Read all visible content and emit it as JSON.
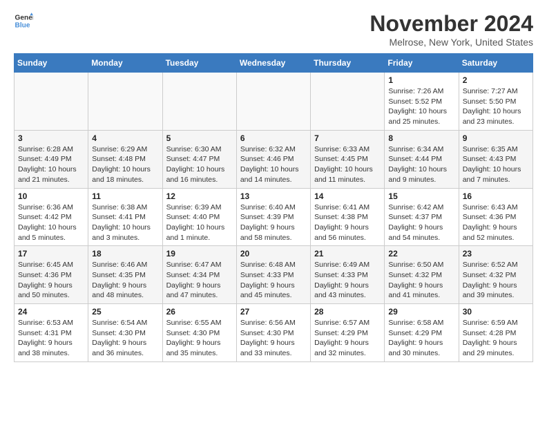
{
  "logo": {
    "line1": "General",
    "line2": "Blue"
  },
  "title": "November 2024",
  "location": "Melrose, New York, United States",
  "weekdays": [
    "Sunday",
    "Monday",
    "Tuesday",
    "Wednesday",
    "Thursday",
    "Friday",
    "Saturday"
  ],
  "weeks": [
    [
      {
        "day": "",
        "info": ""
      },
      {
        "day": "",
        "info": ""
      },
      {
        "day": "",
        "info": ""
      },
      {
        "day": "",
        "info": ""
      },
      {
        "day": "",
        "info": ""
      },
      {
        "day": "1",
        "info": "Sunrise: 7:26 AM\nSunset: 5:52 PM\nDaylight: 10 hours and 25 minutes."
      },
      {
        "day": "2",
        "info": "Sunrise: 7:27 AM\nSunset: 5:50 PM\nDaylight: 10 hours and 23 minutes."
      }
    ],
    [
      {
        "day": "3",
        "info": "Sunrise: 6:28 AM\nSunset: 4:49 PM\nDaylight: 10 hours and 21 minutes."
      },
      {
        "day": "4",
        "info": "Sunrise: 6:29 AM\nSunset: 4:48 PM\nDaylight: 10 hours and 18 minutes."
      },
      {
        "day": "5",
        "info": "Sunrise: 6:30 AM\nSunset: 4:47 PM\nDaylight: 10 hours and 16 minutes."
      },
      {
        "day": "6",
        "info": "Sunrise: 6:32 AM\nSunset: 4:46 PM\nDaylight: 10 hours and 14 minutes."
      },
      {
        "day": "7",
        "info": "Sunrise: 6:33 AM\nSunset: 4:45 PM\nDaylight: 10 hours and 11 minutes."
      },
      {
        "day": "8",
        "info": "Sunrise: 6:34 AM\nSunset: 4:44 PM\nDaylight: 10 hours and 9 minutes."
      },
      {
        "day": "9",
        "info": "Sunrise: 6:35 AM\nSunset: 4:43 PM\nDaylight: 10 hours and 7 minutes."
      }
    ],
    [
      {
        "day": "10",
        "info": "Sunrise: 6:36 AM\nSunset: 4:42 PM\nDaylight: 10 hours and 5 minutes."
      },
      {
        "day": "11",
        "info": "Sunrise: 6:38 AM\nSunset: 4:41 PM\nDaylight: 10 hours and 3 minutes."
      },
      {
        "day": "12",
        "info": "Sunrise: 6:39 AM\nSunset: 4:40 PM\nDaylight: 10 hours and 1 minute."
      },
      {
        "day": "13",
        "info": "Sunrise: 6:40 AM\nSunset: 4:39 PM\nDaylight: 9 hours and 58 minutes."
      },
      {
        "day": "14",
        "info": "Sunrise: 6:41 AM\nSunset: 4:38 PM\nDaylight: 9 hours and 56 minutes."
      },
      {
        "day": "15",
        "info": "Sunrise: 6:42 AM\nSunset: 4:37 PM\nDaylight: 9 hours and 54 minutes."
      },
      {
        "day": "16",
        "info": "Sunrise: 6:43 AM\nSunset: 4:36 PM\nDaylight: 9 hours and 52 minutes."
      }
    ],
    [
      {
        "day": "17",
        "info": "Sunrise: 6:45 AM\nSunset: 4:36 PM\nDaylight: 9 hours and 50 minutes."
      },
      {
        "day": "18",
        "info": "Sunrise: 6:46 AM\nSunset: 4:35 PM\nDaylight: 9 hours and 48 minutes."
      },
      {
        "day": "19",
        "info": "Sunrise: 6:47 AM\nSunset: 4:34 PM\nDaylight: 9 hours and 47 minutes."
      },
      {
        "day": "20",
        "info": "Sunrise: 6:48 AM\nSunset: 4:33 PM\nDaylight: 9 hours and 45 minutes."
      },
      {
        "day": "21",
        "info": "Sunrise: 6:49 AM\nSunset: 4:33 PM\nDaylight: 9 hours and 43 minutes."
      },
      {
        "day": "22",
        "info": "Sunrise: 6:50 AM\nSunset: 4:32 PM\nDaylight: 9 hours and 41 minutes."
      },
      {
        "day": "23",
        "info": "Sunrise: 6:52 AM\nSunset: 4:32 PM\nDaylight: 9 hours and 39 minutes."
      }
    ],
    [
      {
        "day": "24",
        "info": "Sunrise: 6:53 AM\nSunset: 4:31 PM\nDaylight: 9 hours and 38 minutes."
      },
      {
        "day": "25",
        "info": "Sunrise: 6:54 AM\nSunset: 4:30 PM\nDaylight: 9 hours and 36 minutes."
      },
      {
        "day": "26",
        "info": "Sunrise: 6:55 AM\nSunset: 4:30 PM\nDaylight: 9 hours and 35 minutes."
      },
      {
        "day": "27",
        "info": "Sunrise: 6:56 AM\nSunset: 4:30 PM\nDaylight: 9 hours and 33 minutes."
      },
      {
        "day": "28",
        "info": "Sunrise: 6:57 AM\nSunset: 4:29 PM\nDaylight: 9 hours and 32 minutes."
      },
      {
        "day": "29",
        "info": "Sunrise: 6:58 AM\nSunset: 4:29 PM\nDaylight: 9 hours and 30 minutes."
      },
      {
        "day": "30",
        "info": "Sunrise: 6:59 AM\nSunset: 4:28 PM\nDaylight: 9 hours and 29 minutes."
      }
    ]
  ]
}
